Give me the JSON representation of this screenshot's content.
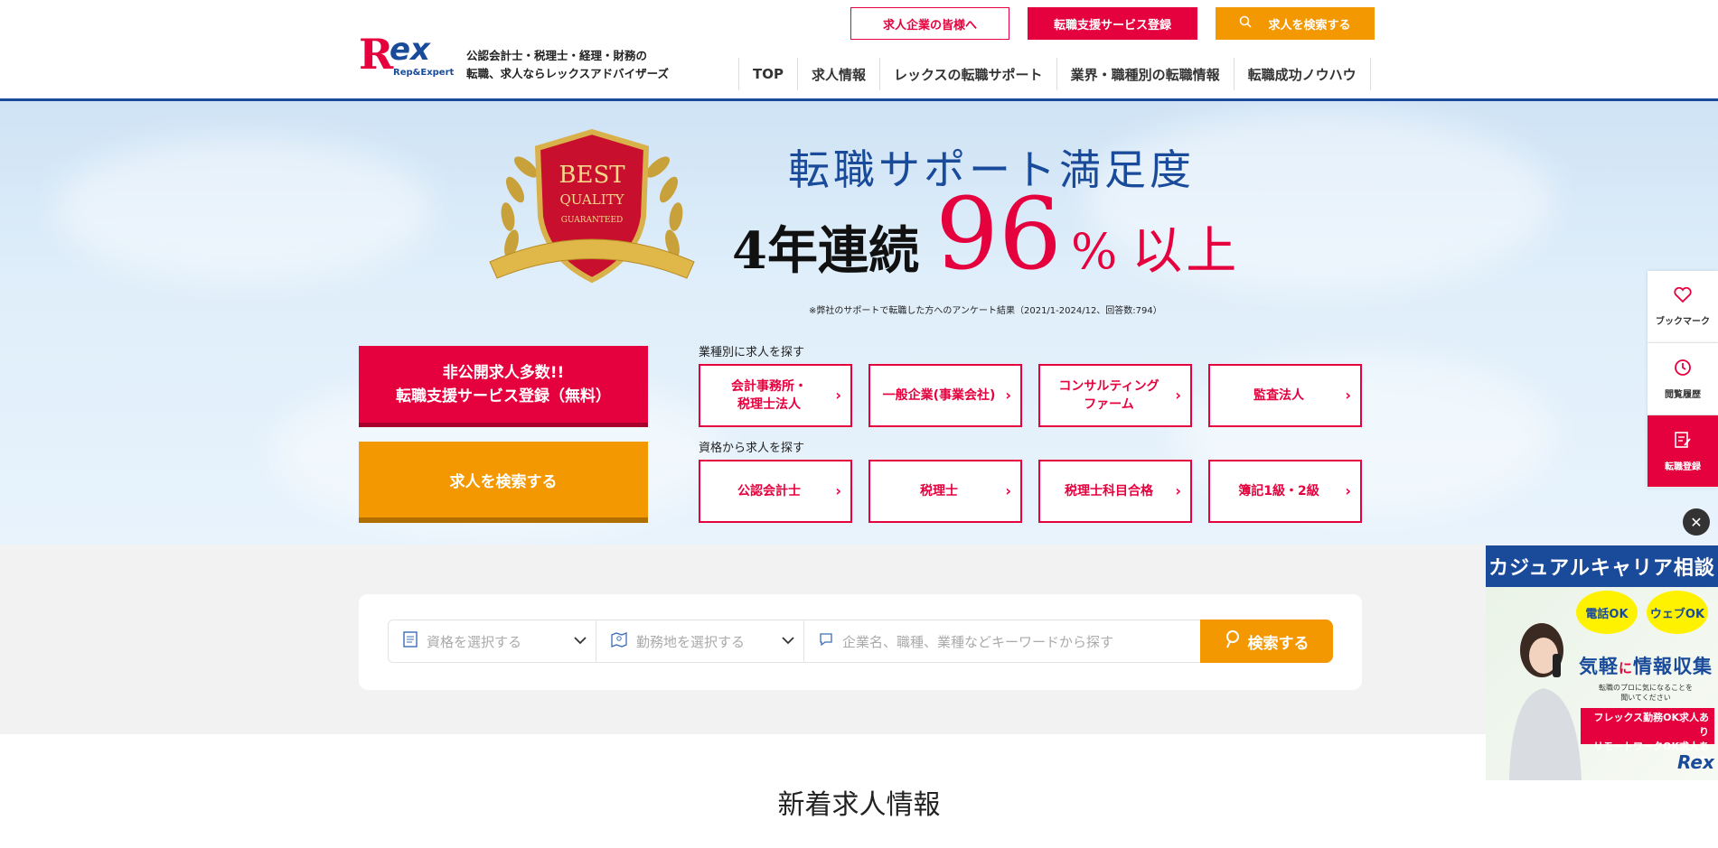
{
  "header": {
    "logo_text": "Rex",
    "logo_sub": "Rep&Expert",
    "tagline_line1": "公認会計士・税理士・経理・財務の",
    "tagline_line2": "転職、求人ならレックスアドバイザーズ",
    "top_buttons": {
      "employers": "求人企業の皆様へ",
      "register": "転職支援サービス登録",
      "search": "求人を検索する"
    },
    "nav": [
      "TOP",
      "求人情報",
      "レックスの転職サポート",
      "業界・職種別の転職情報",
      "転職成功ノウハウ"
    ]
  },
  "hero": {
    "badge_best": "BEST",
    "badge_quality": "QUALITY",
    "badge_guaranteed": "GUARANTEED",
    "title": "転職サポート満足度",
    "big_prefix": "4年連続",
    "big_number": "96",
    "big_percent": "%",
    "big_suffix": "以上",
    "note": "※弊社のサポートで転職した方へのアンケート結果（2021/1-2024/12、回答数:794）",
    "cta_register_line1": "非公開求人多数!!",
    "cta_register_line2": "転職支援サービス登録（無料）",
    "cta_search": "求人を検索する",
    "industry_label": "業種別に求人を探す",
    "industry_tiles": [
      {
        "line1": "会計事務所・",
        "line2": "税理士法人"
      },
      {
        "line1": "一般企業(事業会社)",
        "line2": ""
      },
      {
        "line1": "コンサルティング",
        "line2": "ファーム"
      },
      {
        "line1": "監査法人",
        "line2": ""
      }
    ],
    "qualification_label": "資格から求人を探す",
    "qualification_tiles": [
      "公認会計士",
      "税理士",
      "税理士科目合格",
      "簿記1級・2級"
    ]
  },
  "search": {
    "qualification_placeholder": "資格を選択する",
    "location_placeholder": "勤務地を選択する",
    "keyword_placeholder": "企業名、職種、業種などキーワードから探す",
    "button": "検索する"
  },
  "section_title": "新着求人情報",
  "sidebar": {
    "bookmark": "ブックマーク",
    "history": "閲覧履歴",
    "register": "転職登録"
  },
  "banner": {
    "head": "カジュアルキャリア相談",
    "bubble_phone": "電話OK",
    "bubble_web": "ウェブOK",
    "headline_a": "気軽",
    "headline_ni": "に",
    "headline_b": "情報収集",
    "small_line1": "転職のプロに気になることを",
    "small_line2": "聞いてください",
    "pink_line1": "フレックス勤務OK求人あり",
    "pink_line2": "リモートワークOK求人あり",
    "logo": "Rex"
  },
  "colors": {
    "brand_red": "#e5003e",
    "brand_orange": "#f39800",
    "brand_navy": "#1a4b9b"
  }
}
